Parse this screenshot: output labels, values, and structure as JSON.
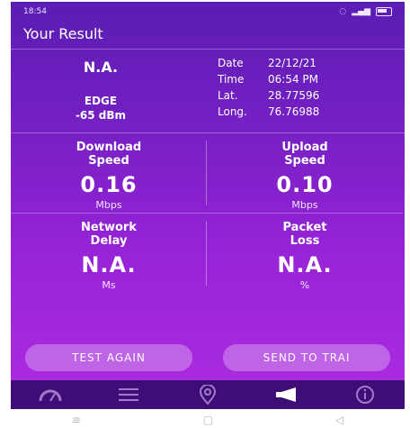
{
  "status": {
    "time": "18:54"
  },
  "header": {
    "title": "Your Result"
  },
  "info": {
    "operator": "N.A.",
    "network": "EDGE",
    "signal": "-65 dBm",
    "date_label": "Date",
    "date_value": "22/12/21",
    "time_label": "Time",
    "time_value": "06:54 PM",
    "lat_label": "Lat.",
    "lat_value": "28.77596",
    "long_label": "Long.",
    "long_value": "76.76988"
  },
  "metrics": {
    "download": {
      "label_line1": "Download",
      "label_line2": "Speed",
      "value": "0.16",
      "unit": "Mbps"
    },
    "upload": {
      "label_line1": "Upload",
      "label_line2": "Speed",
      "value": "0.10",
      "unit": "Mbps"
    },
    "delay": {
      "label_line1": "Network",
      "label_line2": "Delay",
      "value": "N.A.",
      "unit": "Ms"
    },
    "loss": {
      "label_line1": "Packet",
      "label_line2": "Loss",
      "value": "N.A.",
      "unit": "%"
    }
  },
  "buttons": {
    "test_again": "TEST AGAIN",
    "send": "SEND TO TRAI"
  },
  "tabs": [
    "speedometer-icon",
    "list-icon",
    "location-pin-icon",
    "megaphone-icon",
    "info-icon"
  ],
  "colors": {
    "bg_top": "#5a1db3",
    "bg_bottom": "#ae2ce0",
    "tabbar": "#3f0d78"
  }
}
